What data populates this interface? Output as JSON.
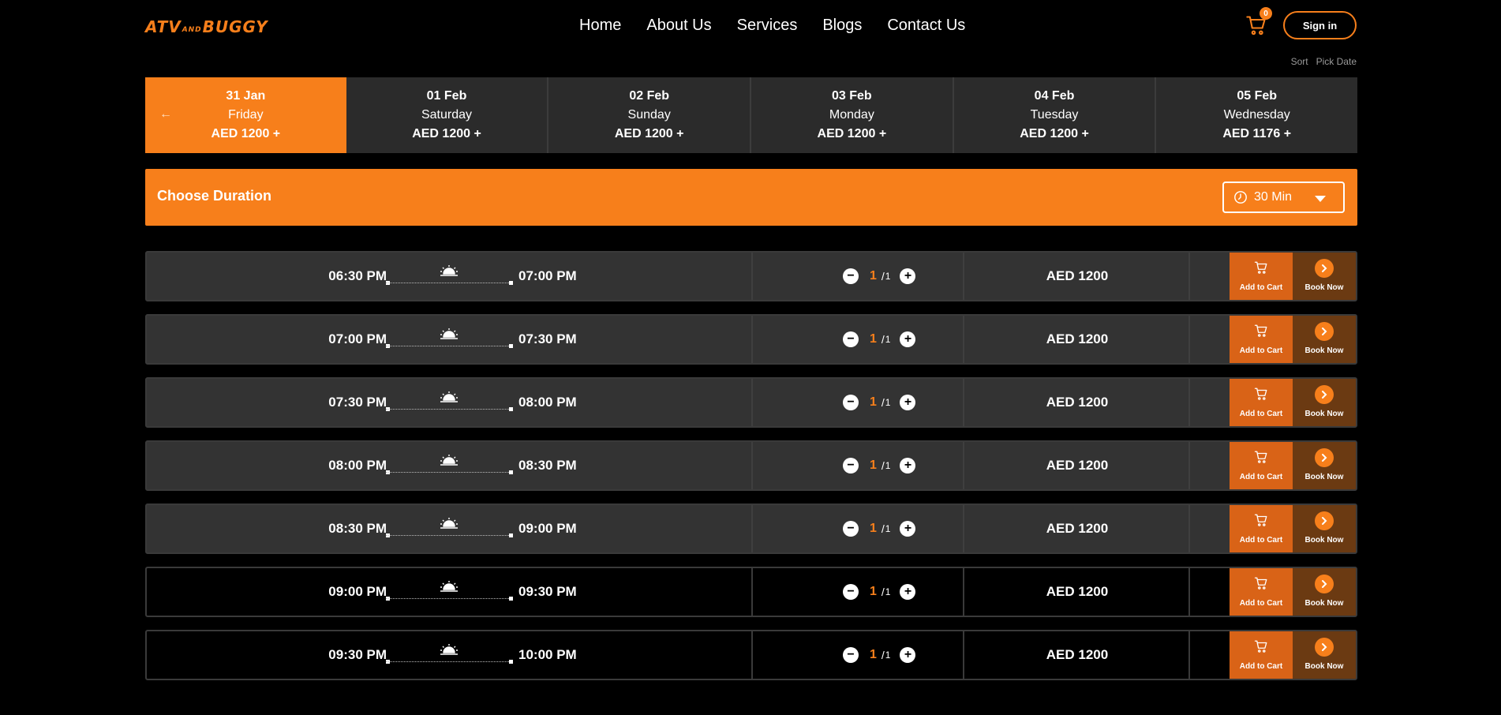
{
  "header": {
    "logo_left": "ATV",
    "logo_mid": "AND",
    "logo_right": "BUGGY",
    "nav": [
      "Home",
      "About Us",
      "Services",
      "Blogs",
      "Contact Us"
    ],
    "cart_count": "0",
    "signin_label": "Sign in",
    "sort_label": "Sort",
    "pick_date_label": "Pick Date"
  },
  "colors": {
    "accent": "#f77f1b",
    "tab_bg": "#2b2b2b",
    "row_bg": "#333333"
  },
  "dates": [
    {
      "date": "31 Jan",
      "day": "Friday",
      "price": "AED 1200 +",
      "active": true
    },
    {
      "date": "01 Feb",
      "day": "Saturday",
      "price": "AED 1200 +"
    },
    {
      "date": "02 Feb",
      "day": "Sunday",
      "price": "AED 1200 +"
    },
    {
      "date": "03 Feb",
      "day": "Monday",
      "price": "AED 1200 +"
    },
    {
      "date": "04 Feb",
      "day": "Tuesday",
      "price": "AED 1200 +"
    },
    {
      "date": "05 Feb",
      "day": "Wednesday",
      "price": "AED 1176 +"
    }
  ],
  "duration": {
    "label": "Choose Duration",
    "value": "30 Min"
  },
  "slots": [
    {
      "start": "06:30 PM",
      "end": "07:00 PM",
      "qty": "1",
      "max": "1",
      "price": "AED 1200",
      "style": "grey"
    },
    {
      "start": "07:00 PM",
      "end": "07:30 PM",
      "qty": "1",
      "max": "1",
      "price": "AED 1200",
      "style": "grey"
    },
    {
      "start": "07:30 PM",
      "end": "08:00 PM",
      "qty": "1",
      "max": "1",
      "price": "AED 1200",
      "style": "grey"
    },
    {
      "start": "08:00 PM",
      "end": "08:30 PM",
      "qty": "1",
      "max": "1",
      "price": "AED 1200",
      "style": "grey"
    },
    {
      "start": "08:30 PM",
      "end": "09:00 PM",
      "qty": "1",
      "max": "1",
      "price": "AED 1200",
      "style": "grey"
    },
    {
      "start": "09:00 PM",
      "end": "09:30 PM",
      "qty": "1",
      "max": "1",
      "price": "AED 1200",
      "style": "dark"
    },
    {
      "start": "09:30 PM",
      "end": "10:00 PM",
      "qty": "1",
      "max": "1",
      "price": "AED 1200",
      "style": "dark"
    }
  ],
  "slot_actions": {
    "add_to_cart": "Add to Cart",
    "book_now": "Book Now"
  },
  "icons": {
    "cart": "cart-icon",
    "sun": "sunset-icon",
    "clock": "clock-icon",
    "back": "arrow-left-icon",
    "next": "chevron-right-icon"
  }
}
